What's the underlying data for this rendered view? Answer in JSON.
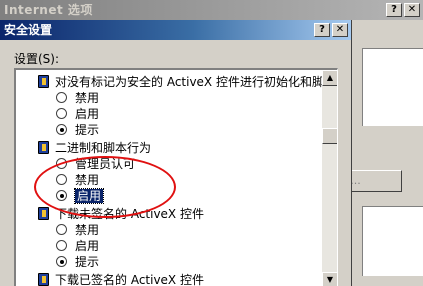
{
  "bg_window": {
    "title": "Internet 选项",
    "controls": {
      "help": "?",
      "close": "✕"
    },
    "button_label": "S)..."
  },
  "dialog": {
    "title": "安全设置",
    "controls": {
      "help": "?",
      "close": "✕"
    },
    "settings_label": "设置(S):",
    "groups": [
      {
        "label": "对没有标记为安全的 ActiveX 控件进行初始化和脚",
        "options": [
          {
            "label": "禁用",
            "checked": false
          },
          {
            "label": "启用",
            "checked": false
          },
          {
            "label": "提示",
            "checked": true
          }
        ]
      },
      {
        "label": "二进制和脚本行为",
        "options": [
          {
            "label": "管理员认可",
            "checked": false
          },
          {
            "label": "禁用",
            "checked": false
          },
          {
            "label": "启用",
            "checked": true,
            "selected": true
          }
        ]
      },
      {
        "label": "下载未签名的 ActiveX 控件",
        "options": [
          {
            "label": "禁用",
            "checked": false
          },
          {
            "label": "启用",
            "checked": false
          },
          {
            "label": "提示",
            "checked": true
          }
        ]
      },
      {
        "label": "下载已签名的 ActiveX 控件"
      }
    ],
    "scroll": {
      "up": "▲",
      "down": "▼"
    }
  },
  "colors": {
    "active_title": "#0a246a",
    "inactive_title": "#808080",
    "highlight_ellipse": "#e01010"
  }
}
